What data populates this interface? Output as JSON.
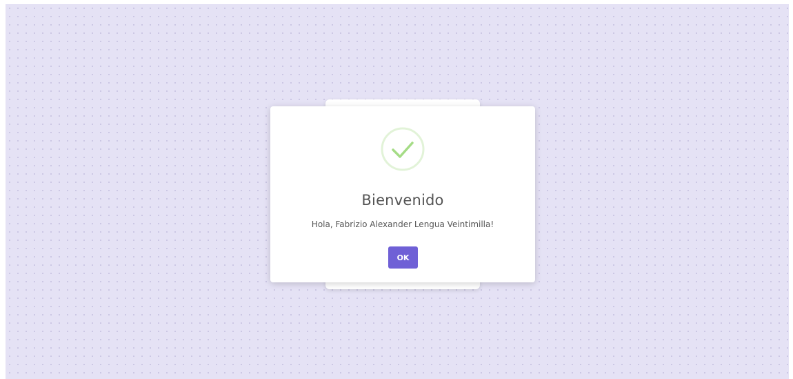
{
  "dialog": {
    "icon": "success-check-icon",
    "title": "Bienvenido",
    "message": "Hola, Fabrizio Alexander Lengua Veintimilla!",
    "ok_label": "OK"
  },
  "colors": {
    "background": "#e5e2f5",
    "accent": "#6f60d6",
    "success": "#a5dc86"
  }
}
